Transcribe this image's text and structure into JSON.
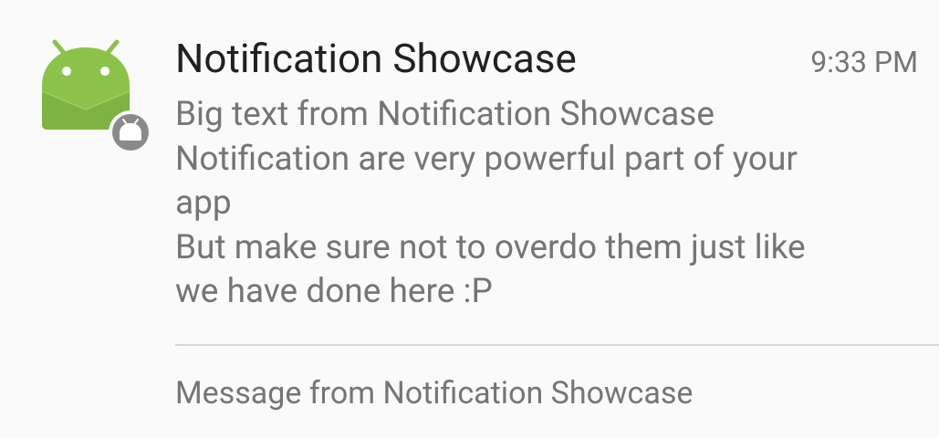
{
  "notification": {
    "app_icon": "android-robot-icon",
    "badge_icon": "android-badge-icon",
    "title": "Notification Showcase",
    "time": "9:33 PM",
    "big_text_lines": [
      "Big text from Notification Showcase",
      "Notification are very powerful part of your",
      "app",
      "But make sure not to overdo them just like",
      "we have done here :P"
    ],
    "summary": "Message from Notification Showcase"
  },
  "colors": {
    "background": "#fafafa",
    "android_green": "#8bc34a",
    "badge_gray": "#8a8a8a",
    "title_text": "#212121",
    "secondary_text": "#757575",
    "divider": "#d6d6d6"
  }
}
